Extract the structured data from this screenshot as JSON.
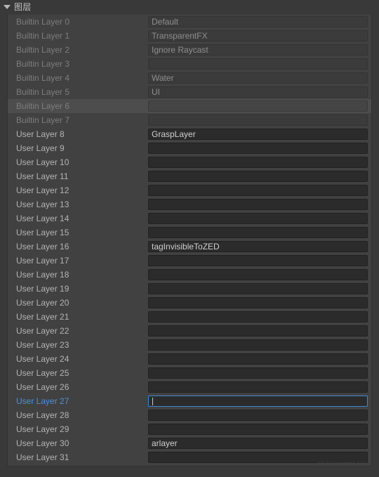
{
  "header": {
    "title": "图层",
    "foldout_icon": "triangle-down-icon",
    "expanded": true
  },
  "colors": {
    "window_background": "#393939",
    "panel_background": "#414141",
    "row_hover": "#4d4d4d",
    "label_user": "#b4b4b4",
    "label_builtin": "#7d7d7d",
    "label_focused": "#4c90d8",
    "field_editable_background": "#2b2b2b",
    "field_readonly_background": "#3b3b3b",
    "focus_border": "#3f87d4",
    "field_text": "#cfcfcf"
  },
  "layers": {
    "rows": [
      {
        "index": 0,
        "label": "Builtin Layer 0",
        "value": "Default",
        "kind": "builtin",
        "state": "normal"
      },
      {
        "index": 1,
        "label": "Builtin Layer 1",
        "value": "TransparentFX",
        "kind": "builtin",
        "state": "normal"
      },
      {
        "index": 2,
        "label": "Builtin Layer 2",
        "value": "Ignore Raycast",
        "kind": "builtin",
        "state": "normal"
      },
      {
        "index": 3,
        "label": "Builtin Layer 3",
        "value": "",
        "kind": "builtin",
        "state": "normal"
      },
      {
        "index": 4,
        "label": "Builtin Layer 4",
        "value": "Water",
        "kind": "builtin",
        "state": "normal"
      },
      {
        "index": 5,
        "label": "Builtin Layer 5",
        "value": "UI",
        "kind": "builtin",
        "state": "normal"
      },
      {
        "index": 6,
        "label": "Builtin Layer 6",
        "value": "",
        "kind": "builtin",
        "state": "hovered"
      },
      {
        "index": 7,
        "label": "Builtin Layer 7",
        "value": "",
        "kind": "builtin",
        "state": "normal"
      },
      {
        "index": 8,
        "label": "User Layer 8",
        "value": "GraspLayer",
        "kind": "user",
        "state": "normal"
      },
      {
        "index": 9,
        "label": "User Layer 9",
        "value": "",
        "kind": "user",
        "state": "normal"
      },
      {
        "index": 10,
        "label": "User Layer 10",
        "value": "",
        "kind": "user",
        "state": "normal"
      },
      {
        "index": 11,
        "label": "User Layer 11",
        "value": "",
        "kind": "user",
        "state": "normal"
      },
      {
        "index": 12,
        "label": "User Layer 12",
        "value": "",
        "kind": "user",
        "state": "normal"
      },
      {
        "index": 13,
        "label": "User Layer 13",
        "value": "",
        "kind": "user",
        "state": "normal"
      },
      {
        "index": 14,
        "label": "User Layer 14",
        "value": "",
        "kind": "user",
        "state": "normal"
      },
      {
        "index": 15,
        "label": "User Layer 15",
        "value": "",
        "kind": "user",
        "state": "normal"
      },
      {
        "index": 16,
        "label": "User Layer 16",
        "value": "tagInvisibleToZED",
        "kind": "user",
        "state": "normal"
      },
      {
        "index": 17,
        "label": "User Layer 17",
        "value": "",
        "kind": "user",
        "state": "normal"
      },
      {
        "index": 18,
        "label": "User Layer 18",
        "value": "",
        "kind": "user",
        "state": "normal"
      },
      {
        "index": 19,
        "label": "User Layer 19",
        "value": "",
        "kind": "user",
        "state": "normal"
      },
      {
        "index": 20,
        "label": "User Layer 20",
        "value": "",
        "kind": "user",
        "state": "normal"
      },
      {
        "index": 21,
        "label": "User Layer 21",
        "value": "",
        "kind": "user",
        "state": "normal"
      },
      {
        "index": 22,
        "label": "User Layer 22",
        "value": "",
        "kind": "user",
        "state": "normal"
      },
      {
        "index": 23,
        "label": "User Layer 23",
        "value": "",
        "kind": "user",
        "state": "normal"
      },
      {
        "index": 24,
        "label": "User Layer 24",
        "value": "",
        "kind": "user",
        "state": "normal"
      },
      {
        "index": 25,
        "label": "User Layer 25",
        "value": "",
        "kind": "user",
        "state": "normal"
      },
      {
        "index": 26,
        "label": "User Layer 26",
        "value": "",
        "kind": "user",
        "state": "normal"
      },
      {
        "index": 27,
        "label": "User Layer 27",
        "value": "",
        "kind": "user",
        "state": "focused"
      },
      {
        "index": 28,
        "label": "User Layer 28",
        "value": "",
        "kind": "user",
        "state": "normal"
      },
      {
        "index": 29,
        "label": "User Layer 29",
        "value": "",
        "kind": "user",
        "state": "normal"
      },
      {
        "index": 30,
        "label": "User Layer 30",
        "value": "arlayer",
        "kind": "user",
        "state": "normal"
      },
      {
        "index": 31,
        "label": "User Layer 31",
        "value": "",
        "kind": "user",
        "state": "normal"
      }
    ]
  },
  "watermark": {
    "text": "https://blog.csdn.net/weixin_00000"
  }
}
